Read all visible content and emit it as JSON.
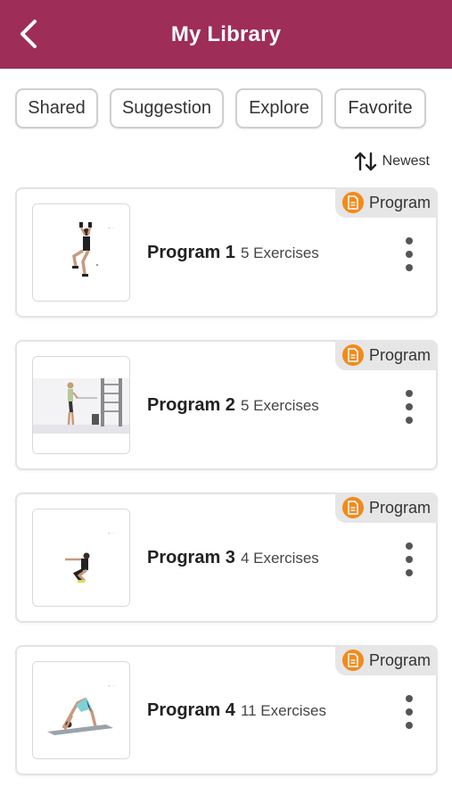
{
  "header": {
    "title": "My Library",
    "back_icon": "chevron-left-icon",
    "bg_color": "#9e2d58"
  },
  "filters": [
    {
      "label": "Shared"
    },
    {
      "label": "Suggestion"
    },
    {
      "label": "Explore"
    },
    {
      "label": "Favorite"
    }
  ],
  "sort": {
    "label": "Newest",
    "icon": "sort-arrows-icon"
  },
  "programs": [
    {
      "name": "Program 1",
      "count": "5 Exercises",
      "badge": "Program",
      "thumb": "dumbbell-overhead-squat"
    },
    {
      "name": "Program 2",
      "count": "5 Exercises",
      "badge": "Program",
      "thumb": "cable-machine-standing"
    },
    {
      "name": "Program 3",
      "count": "4 Exercises",
      "badge": "Program",
      "thumb": "squat-arms-forward"
    },
    {
      "name": "Program 4",
      "count": "11 Exercises",
      "badge": "Program",
      "thumb": "downward-dog-on-mat"
    }
  ],
  "badge_color": "#f28a1c"
}
